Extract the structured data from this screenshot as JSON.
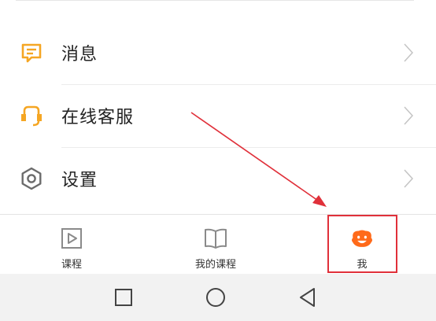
{
  "menu": {
    "items": [
      {
        "label": "消息",
        "icon": "message-icon"
      },
      {
        "label": "在线客服",
        "icon": "customer-service-icon"
      },
      {
        "label": "设置",
        "icon": "settings-icon"
      }
    ]
  },
  "tabbar": {
    "tabs": [
      {
        "label": "课程",
        "icon": "play-icon"
      },
      {
        "label": "我的课程",
        "icon": "book-icon"
      },
      {
        "label": "我",
        "icon": "face-icon",
        "selected": true
      }
    ]
  },
  "navbar": {
    "buttons": [
      "square-icon",
      "circle-icon",
      "back-triangle-icon"
    ]
  },
  "colors": {
    "accent": "#f5a623",
    "selected_tab": "#ff6a1a",
    "annotation": "#e0303a",
    "icon_gray": "#6b6b6b"
  }
}
